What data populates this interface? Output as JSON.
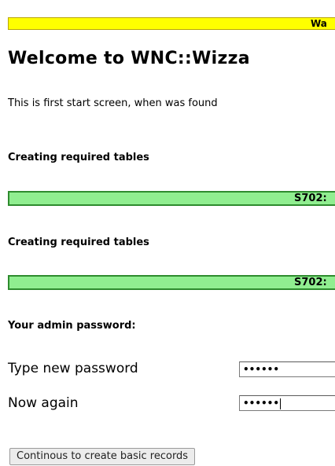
{
  "warning_bar": {
    "text": "Wa"
  },
  "header": {
    "title": "Welcome to WNC::Wizza"
  },
  "intro": {
    "text": "This is first start screen, when was found"
  },
  "steps": [
    {
      "label": "Creating required tables",
      "status": "S702:"
    },
    {
      "label": "Creating required tables",
      "status": "S702:"
    }
  ],
  "admin": {
    "heading": "Your admin password:",
    "fields": [
      {
        "label": "Type new password",
        "masked_value": "••••••"
      },
      {
        "label": "Now again",
        "masked_value": "••••••"
      }
    ]
  },
  "actions": {
    "continue_label": "Continous to create basic records"
  },
  "colors": {
    "warning_bg": "#ffff00",
    "success_bg": "#90ee90",
    "success_border": "#2e8b2e"
  }
}
